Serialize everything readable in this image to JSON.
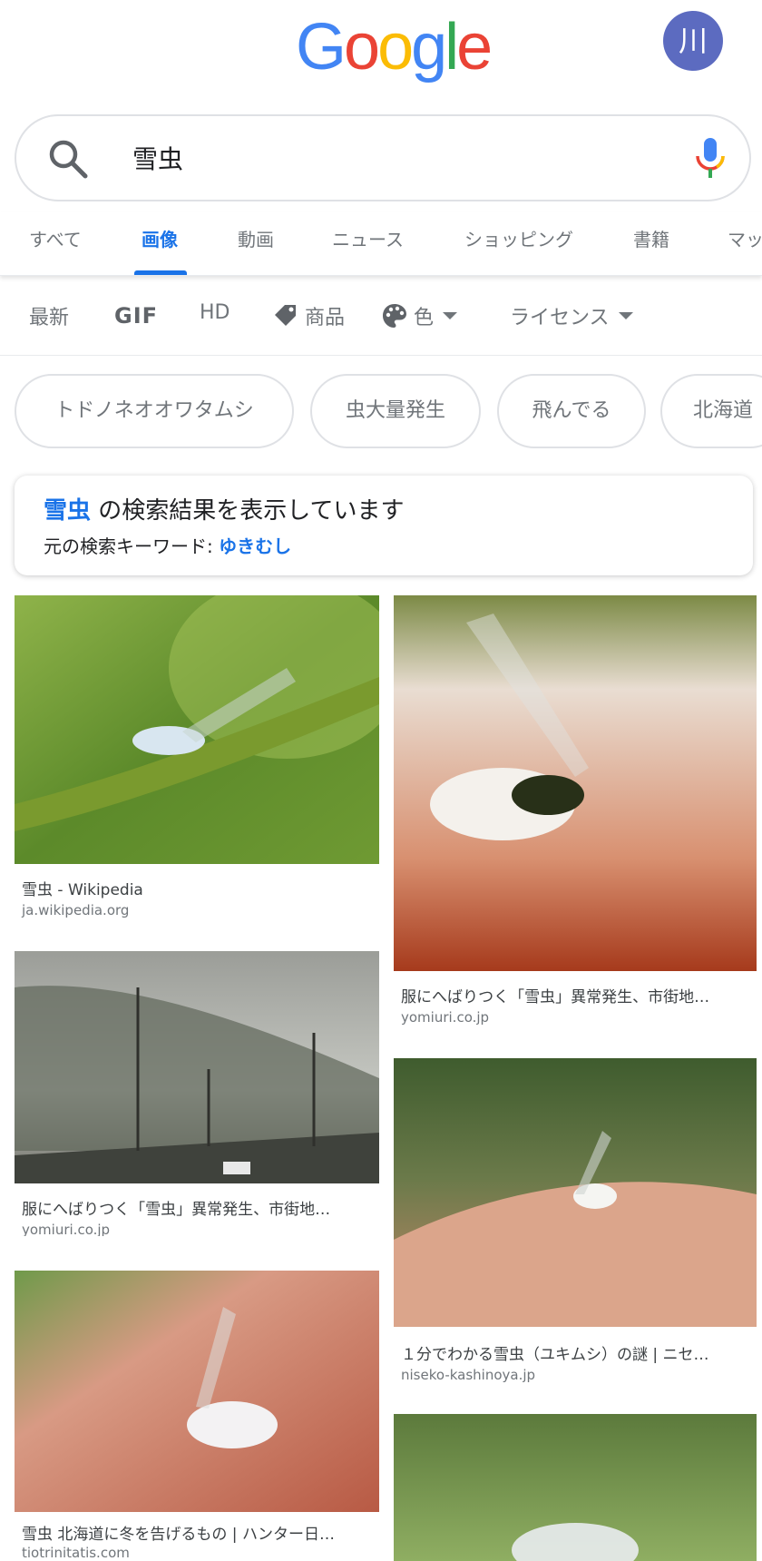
{
  "header": {
    "logo": "Google",
    "avatar_initial": "川"
  },
  "search": {
    "query": "雪虫"
  },
  "tabs": [
    {
      "label": "すべて",
      "active": false
    },
    {
      "label": "画像",
      "active": true
    },
    {
      "label": "動画",
      "active": false
    },
    {
      "label": "ニュース",
      "active": false
    },
    {
      "label": "ショッピング",
      "active": false
    },
    {
      "label": "書籍",
      "active": false
    },
    {
      "label": "マッ",
      "active": false
    }
  ],
  "filters": {
    "latest": "最新",
    "gif": "GIF",
    "hd": "HD",
    "products": "商品",
    "color": "色",
    "license": "ライセンス"
  },
  "chips": [
    "トドノネオオワタムシ",
    "虫大量発生",
    "飛んでる",
    "北海道"
  ],
  "notice": {
    "keyword": "雪虫",
    "message": " の検索結果を表示しています",
    "original_label": "元の検索キーワード: ",
    "original_query": "ゆきむし"
  },
  "results": [
    {
      "title": "雪虫 - Wikipedia",
      "domain": "ja.wikipedia.org"
    },
    {
      "title": "服にへばりつく「雪虫」異常発生、市街地…",
      "domain": "yomiuri.co.jp"
    },
    {
      "title": "服にへばりつく「雪虫」異常発生、市街地…",
      "domain": "yomiuri.co.jp"
    },
    {
      "title": "１分でわかる雪虫（ユキムシ）の謎 | ニセ…",
      "domain": "niseko-kashinoya.jp"
    },
    {
      "title": "雪虫 北海道に冬を告げるもの | ハンター日…",
      "domain": "tiotrinitatis.com"
    }
  ],
  "colors": {
    "accent": "#1a73e8",
    "avatar": "#5c6bc0",
    "chip_border": "#dfe1e5",
    "muted_text": "#70757a"
  }
}
